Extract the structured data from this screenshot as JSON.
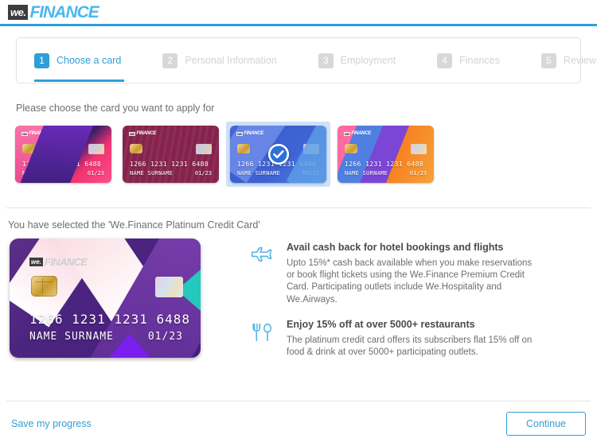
{
  "brand": {
    "mark": "we.",
    "name": "FINANCE",
    "accent": "#2f9fd8",
    "logo_blue": "#49b8ee"
  },
  "stepper": {
    "steps": [
      {
        "num": "1",
        "label": "Choose a card",
        "active": true
      },
      {
        "num": "2",
        "label": "Personal Information",
        "active": false
      },
      {
        "num": "3",
        "label": "Employment",
        "active": false
      },
      {
        "num": "4",
        "label": "Finances",
        "active": false
      },
      {
        "num": "5",
        "label": "Review & Sign",
        "active": false
      }
    ]
  },
  "chooser": {
    "prompt": "Please choose the card you want to apply for",
    "cards": [
      {
        "logo_mark": "we.",
        "logo_name": "FINANCE",
        "number": "1266 1231 1231 6488",
        "name": "NAME SURNAME",
        "expiry": "01/23",
        "theme": "pink-magenta",
        "selected": false
      },
      {
        "logo_mark": "we.",
        "logo_name": "FINANCE",
        "number": "1266 1231 1231 6488",
        "name": "NAME SURNAME",
        "expiry": "01/23",
        "theme": "maroon",
        "selected": false
      },
      {
        "logo_mark": "we.",
        "logo_name": "FINANCE",
        "number": "1266 1231 1231 6488",
        "name": "NAME SURNAME",
        "expiry": "01/23",
        "theme": "blue",
        "selected": true
      },
      {
        "logo_mark": "we.",
        "logo_name": "FINANCE",
        "number": "1266 1231 1231 6488",
        "name": "NAME SURNAME",
        "expiry": "01/23",
        "theme": "rainbow",
        "selected": false
      }
    ],
    "selected_index": 2,
    "check_icon": "check-circle-icon"
  },
  "detail": {
    "selection_text": "You have selected the 'We.Finance Platinum Credit Card'",
    "card": {
      "logo_mark": "we.",
      "logo_name": "FINANCE",
      "number": "1266 1231 1231 6488",
      "name": "NAME SURNAME",
      "expiry": "01/23",
      "theme": "purple-platinum"
    },
    "benefits": [
      {
        "icon": "airplane-icon",
        "title": "Avail cash back for hotel bookings and flights",
        "body": "Upto 15%* cash back available when you make reservations or book flight tickets using the We.Finance Premium Credit Card. Participating outlets include We.Hospitality and We.Airways."
      },
      {
        "icon": "cutlery-icon",
        "title": "Enjoy 15% off at over 5000+ restaurants",
        "body": "The platinum credit card offers its subscribers flat 15% off on food & drink at over 5000+ participating outlets."
      }
    ]
  },
  "footer": {
    "save_label": "Save my progress",
    "continue_label": "Continue"
  }
}
